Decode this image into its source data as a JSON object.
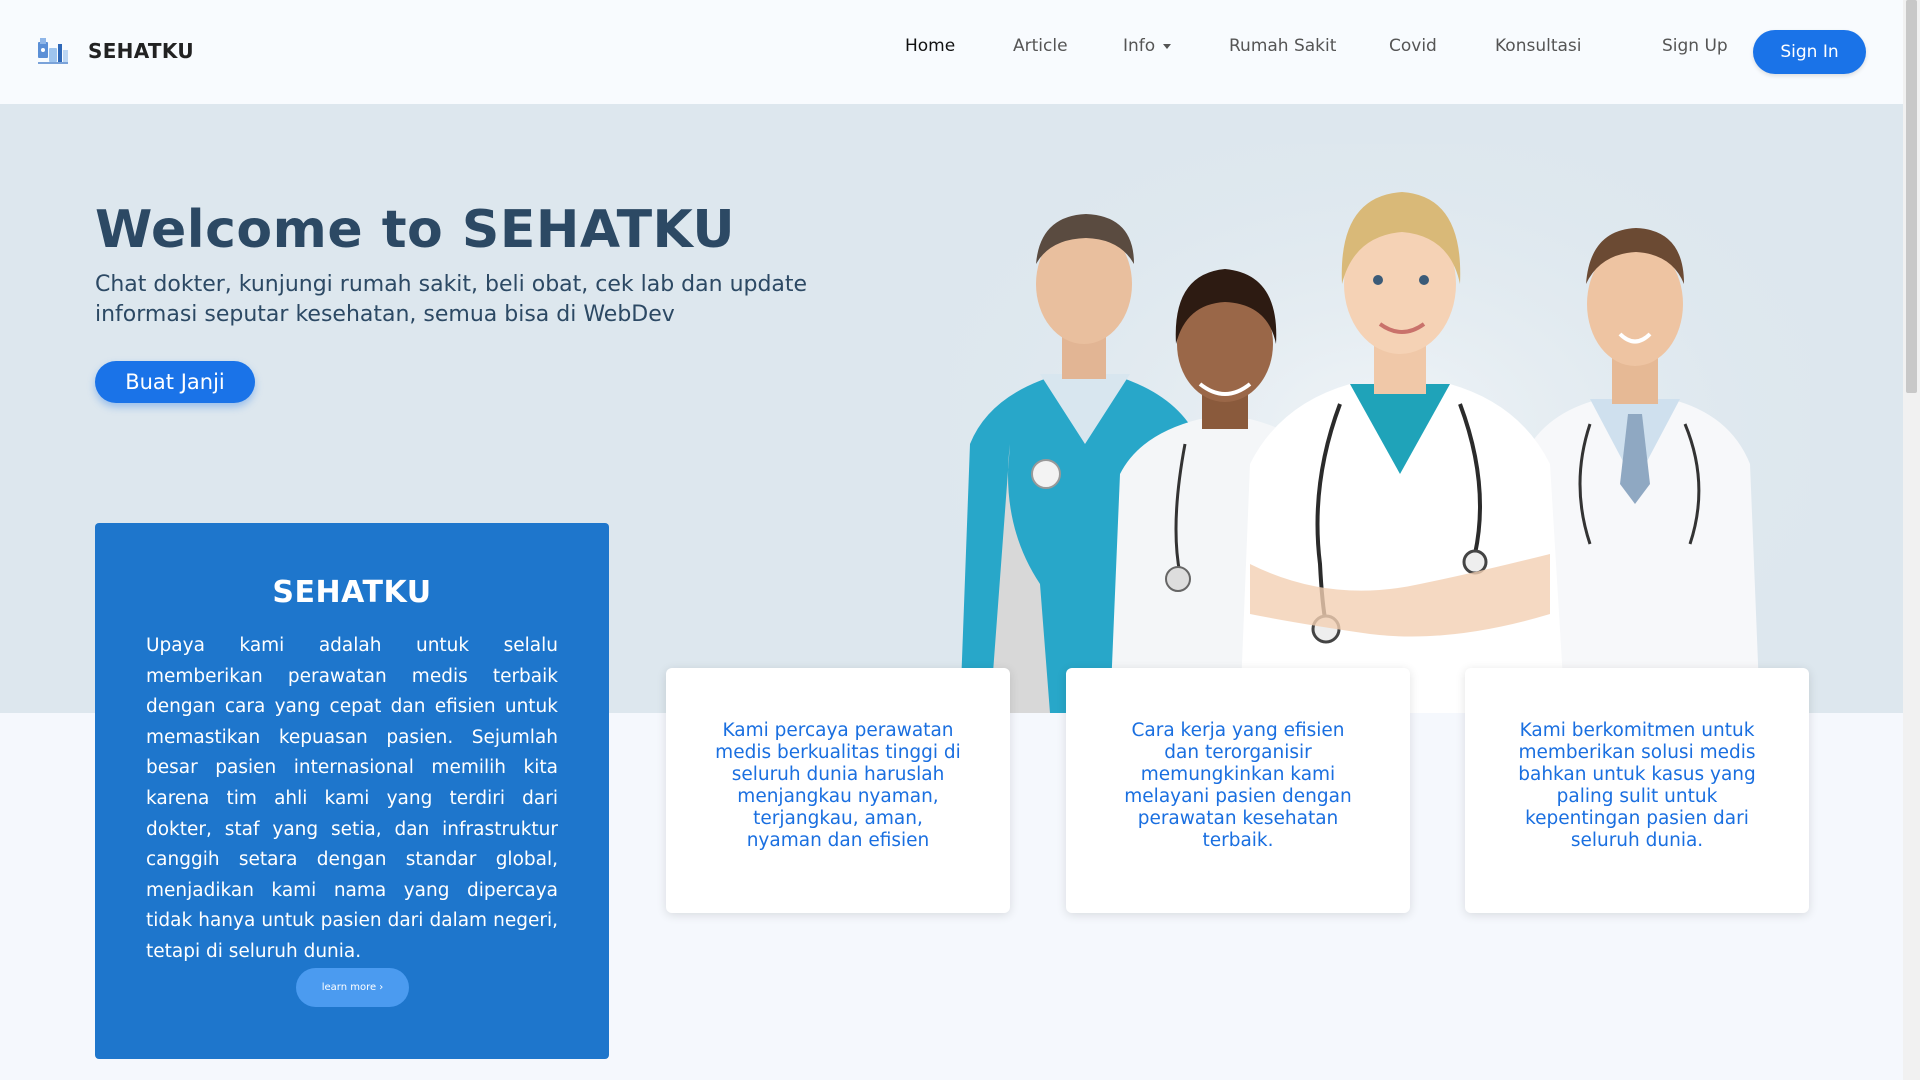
{
  "nav": {
    "brand": "SEHATKU",
    "links": [
      "Home",
      "Article",
      "Info",
      "Rumah Sakit",
      "Covid",
      "Konsultasi"
    ],
    "active": "Home",
    "signup": "Sign Up",
    "signin": "Sign In"
  },
  "hero": {
    "title": "Welcome to SEHATKU",
    "subtitle": "Chat dokter, kunjungi rumah sakit, beli obat, cek lab dan update informasi seputar kesehatan, semua bisa di WebDev",
    "cta": "Buat Janji"
  },
  "about": {
    "title": "SEHATKU",
    "text": "Upaya kami adalah untuk selalu memberikan perawatan medis terbaik dengan cara yang cepat dan efisien untuk memastikan kepuasan pasien. Sejumlah besar pasien internasional memilih kita karena tim ahli kami yang terdiri dari dokter, staf yang setia, dan infrastruktur canggih setara dengan standar global, menjadikan kami nama yang dipercaya tidak hanya untuk pasien dari dalam negeri, tetapi di seluruh dunia.",
    "button": "learn more ›"
  },
  "cards": [
    "Kami percaya perawatan medis berkualitas tinggi di seluruh dunia haruslah menjangkau nyaman, terjangkau, aman, nyaman dan efisien",
    "Cara kerja yang efisien dan terorganisir memungkinkan kami melayani pasien dengan perawatan kesehatan terbaik.",
    "Kami berkomitmen untuk memberikan solusi medis bahkan untuk kasus yang paling sulit untuk kepentingan pasien dari seluruh dunia."
  ],
  "colors": {
    "primary": "#1a73e8",
    "heading": "#2c4964",
    "about_bg": "#1e76cc",
    "hero_bg": "#dde7ee"
  }
}
